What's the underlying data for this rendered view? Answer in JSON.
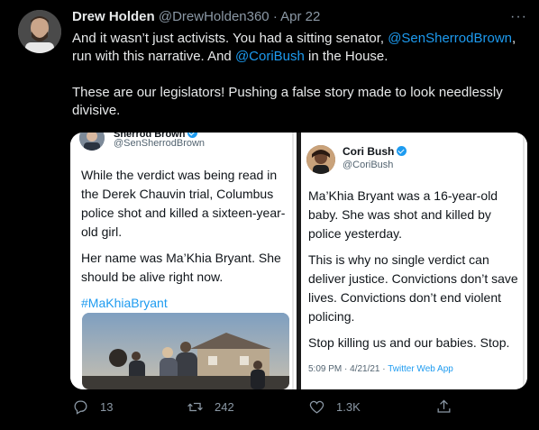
{
  "author": {
    "name": "Drew Holden",
    "handle": "@DrewHolden360",
    "separator": "·",
    "date": "Apr 22"
  },
  "more_label": "···",
  "tweet": {
    "line1_pre": "And it wasn’t just activists. You had a sitting senator, ",
    "mention1": "@SenSherrodBrown",
    "line1_mid": ", run with this narrative. And ",
    "mention2": "@CoriBush",
    "line1_post": " in the House.",
    "para2": "These are our legislators! Pushing a false story made to look needlessly divisive."
  },
  "left_embed": {
    "name": "Sherrod Brown",
    "handle": "@SenSherrodBrown",
    "para1": "While the verdict was being read in the Derek Chauvin trial, Columbus police shot and killed a sixteen-year-old girl.",
    "para2": "Her name was Ma’Khia Bryant. She should be alive right now.",
    "hashtag": "#MaKhiaBryant"
  },
  "right_embed": {
    "name": "Cori Bush",
    "handle": "@CoriBush",
    "para1": "Ma’Khia Bryant was a 16-year-old baby. She was shot and killed by police yesterday.",
    "para2": "This is why no single verdict can deliver justice. Convictions don’t save lives. Convictions don’t end violent policing.",
    "para3": "Stop killing us and our babies. Stop.",
    "footer_time": "5:09 PM · 4/21/21 · ",
    "footer_source": "Twitter Web App"
  },
  "actions": {
    "replies": "13",
    "retweets": "242",
    "likes": "1.3K"
  },
  "colors": {
    "background": "#000000",
    "link": "#1d9bf0",
    "muted": "#8b98a5"
  }
}
